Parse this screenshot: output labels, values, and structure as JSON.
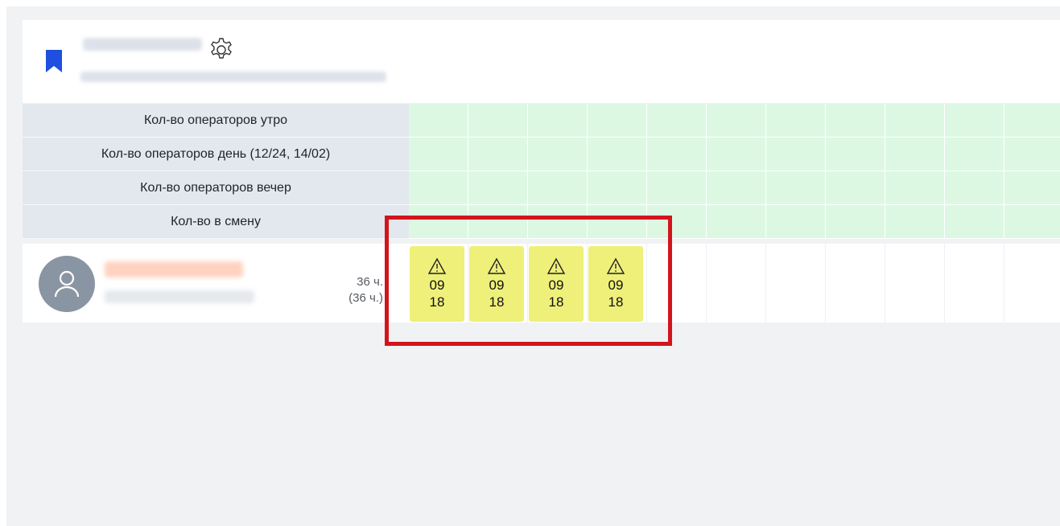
{
  "header": {
    "accent_color": "#1e4fe0",
    "bookmark_icon": "bookmark-icon",
    "settings_icon": "gear-icon"
  },
  "rows": {
    "labels": [
      "Кол-во операторов утро",
      "Кол-во операторов день (12/24, 14/02)",
      "Кол-во операторов вечер",
      "Кол-во в смену"
    ]
  },
  "operator": {
    "avatar_icon": "user-avatar-icon",
    "hours": "36 ч.",
    "hours_total": "(36 ч.)",
    "shifts": [
      {
        "start": "09",
        "end": "18",
        "icon": "warning-icon"
      },
      {
        "start": "09",
        "end": "18",
        "icon": "warning-icon"
      },
      {
        "start": "09",
        "end": "18",
        "icon": "warning-icon"
      },
      {
        "start": "09",
        "end": "18",
        "icon": "warning-icon"
      }
    ]
  },
  "colors": {
    "green_cell": "#dcf8e3",
    "shift_yellow": "#eef07a",
    "highlight_red": "#d3141b"
  }
}
